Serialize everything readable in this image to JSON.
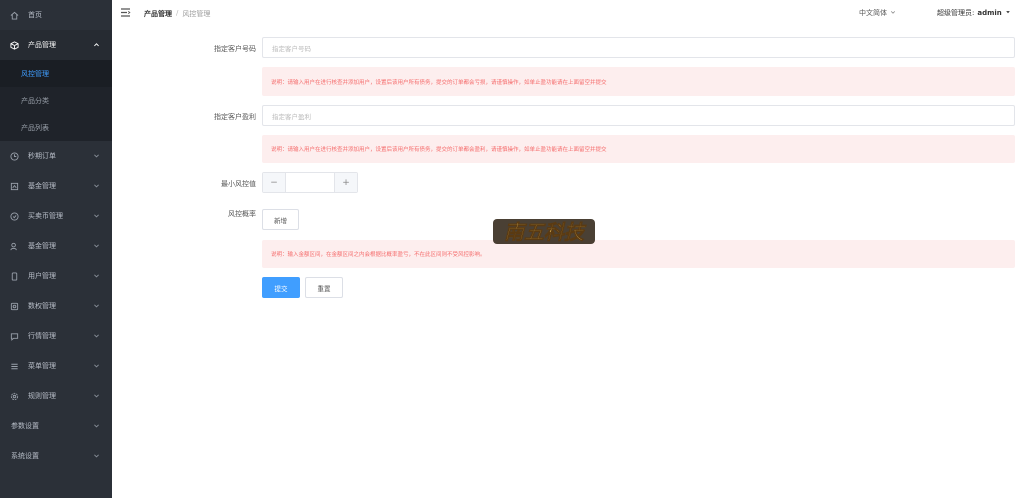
{
  "sidebar": {
    "items": [
      {
        "label": "首页",
        "icon": "home-icon"
      },
      {
        "label": "产品管理",
        "icon": "box-icon",
        "expanded": true,
        "children": [
          "风控管理",
          "产品分类",
          "产品列表"
        ]
      },
      {
        "label": "秒期订单",
        "icon": "clock-icon"
      },
      {
        "label": "基金管理",
        "icon": "fund-icon"
      },
      {
        "label": "买卖币管理",
        "icon": "coin-icon"
      },
      {
        "label": "基金管理",
        "icon": "people-icon"
      },
      {
        "label": "用户管理",
        "icon": "phone-icon"
      },
      {
        "label": "数权管理",
        "icon": "safe-icon"
      },
      {
        "label": "行情管理",
        "icon": "chat-icon"
      },
      {
        "label": "菜单管理",
        "icon": "list-icon"
      },
      {
        "label": "规则管理",
        "icon": "gear-icon"
      },
      {
        "label": "参数设置"
      },
      {
        "label": "系统设置"
      }
    ],
    "active_child": "风控管理"
  },
  "header": {
    "breadcrumb": [
      "产品管理",
      "风控管理"
    ],
    "breadcrumb_sep": "/",
    "language": "中文简体",
    "user_prefix": "超级管理员:",
    "user_name": "admin"
  },
  "form": {
    "account_label": "指定客户号码",
    "account_placeholder": "指定客户号码",
    "account_notice": "说明：请输入用户在进行核查并添加用户，设置后该用户所有债务，提交的订单都会亏损，请谨慎操作，如单止盈功能请在上面留空并提交",
    "profit_label": "指定客户盈利",
    "profit_placeholder": "指定客户盈利",
    "profit_notice": "说明：请输入用户在进行核查并添加用户，设置后该用户所有债务，提交的订单都会盈利，请谨慎操作，如单止盈功能请在上面留空并提交",
    "min_label": "最小风控值",
    "stepper_minus": "−",
    "stepper_plus": "+",
    "rate_label": "风控概率",
    "add_label": "新增",
    "rate_notice": "说明：输入金额区间，在金额区间之内会根据比概率盈亏，不在此区间则不受风控影响。",
    "submit_label": "提交",
    "reset_label": "重置"
  },
  "watermark": {
    "text": "南五科技"
  },
  "colors": {
    "sidebar_bg": "#2b3038",
    "accent": "#409eff",
    "alert_bg": "#fdeeee",
    "alert_text": "#f56c6c"
  }
}
